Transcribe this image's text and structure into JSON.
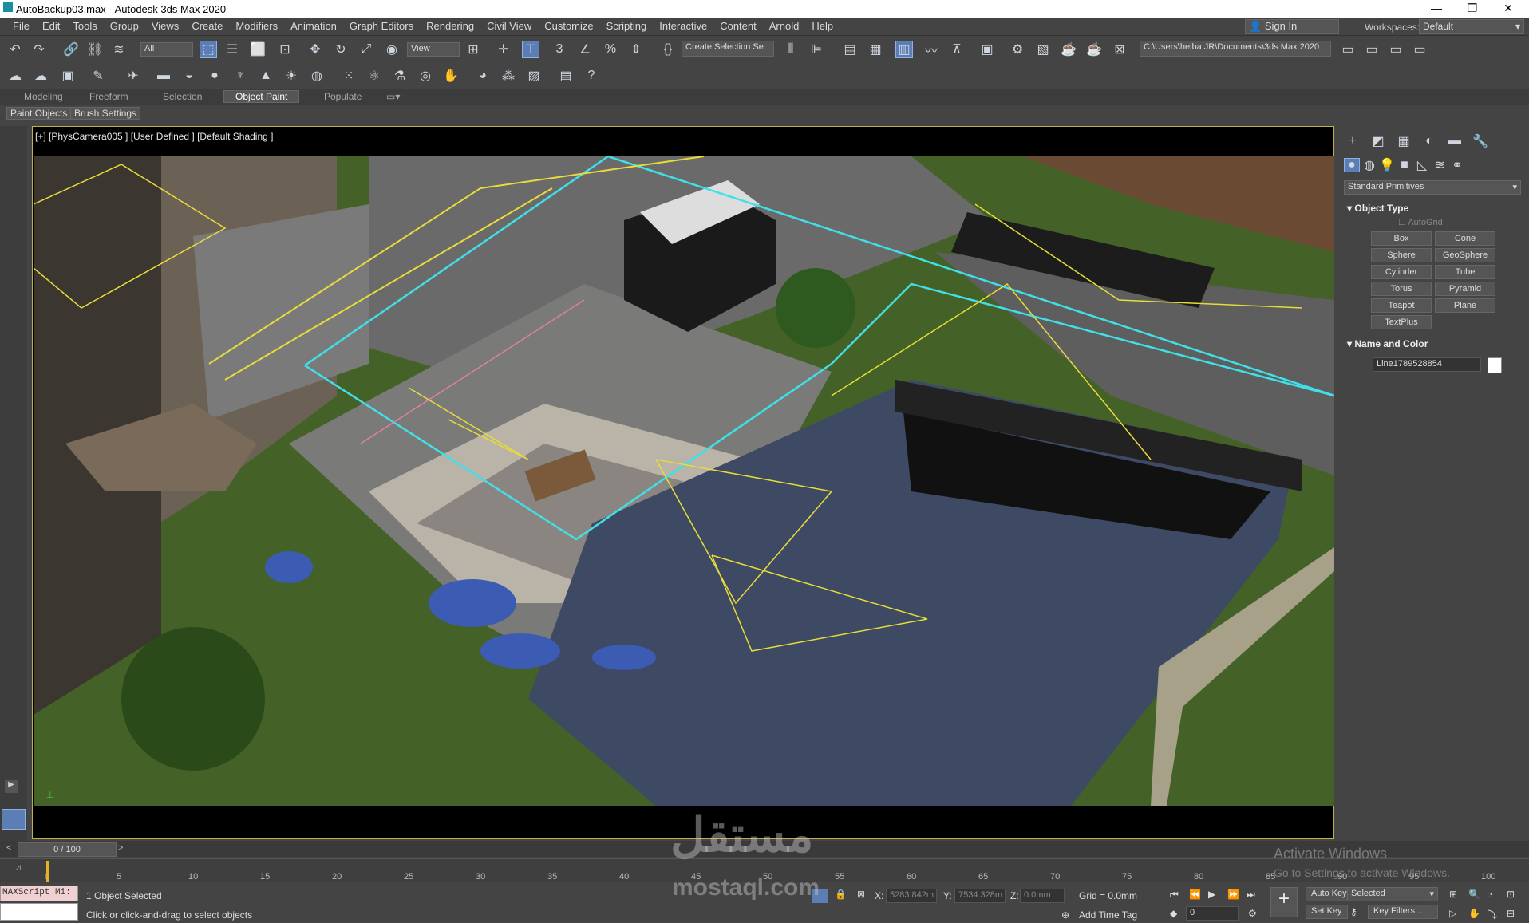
{
  "window": {
    "title": "AutoBackup03.max - Autodesk 3ds Max 2020",
    "minimize": "—",
    "maximize": "❐",
    "close": "✕"
  },
  "menu": {
    "items": [
      "File",
      "Edit",
      "Tools",
      "Group",
      "Views",
      "Create",
      "Modifiers",
      "Animation",
      "Graph Editors",
      "Rendering",
      "Civil View",
      "Customize",
      "Scripting",
      "Interactive",
      "Content",
      "Arnold",
      "Help"
    ],
    "sign_in": "Sign In",
    "workspaces_label": "Workspaces:",
    "workspaces_value": "Default"
  },
  "toolbar": {
    "filter": "All",
    "ref_coord": "View",
    "selection_set": "Create Selection Se",
    "project_path": "C:\\Users\\heiba JR\\Documents\\3ds Max 2020"
  },
  "ribbon": {
    "tabs": [
      "Modeling",
      "Freeform",
      "Selection",
      "Object Paint",
      "Populate"
    ],
    "active_tab": "Object Paint",
    "sub_buttons": [
      "Paint Objects",
      "Brush Settings"
    ]
  },
  "viewport": {
    "label": "[+] [PhysCamera005 ] [User Defined ] [Default Shading ]"
  },
  "command_panel": {
    "category": "Standard Primitives",
    "object_type_title": "Object Type",
    "autogrid": "AutoGrid",
    "buttons": [
      "Box",
      "Cone",
      "Sphere",
      "GeoSphere",
      "Cylinder",
      "Tube",
      "Torus",
      "Pyramid",
      "Teapot",
      "Plane",
      "TextPlus"
    ],
    "name_color_title": "Name and Color",
    "object_name": "Line1789528854",
    "object_color": "#ffffff"
  },
  "timeline": {
    "frame_display": "0 / 100",
    "ticks": [
      "0",
      "5",
      "10",
      "15",
      "20",
      "25",
      "30",
      "35",
      "40",
      "45",
      "50",
      "55",
      "60",
      "65",
      "70",
      "75",
      "80",
      "85",
      "90",
      "95",
      "100"
    ]
  },
  "status": {
    "maxscript": "MAXScript Mi:",
    "selected_count": "1 Object Selected",
    "prompt": "Click or click-and-drag to select objects",
    "x_label": "X:",
    "x_value": "5283.842m",
    "y_label": "Y:",
    "y_value": "7534.328m",
    "z_label": "Z:",
    "z_value": "0.0mm",
    "grid": "Grid = 0.0mm",
    "add_time_tag": "Add Time Tag",
    "auto_key": "Auto Key",
    "set_key": "Set Key",
    "key_mode": "Selected",
    "key_filters": "Key Filters...",
    "current_frame": "0"
  },
  "overlay": {
    "activate_title": "Activate Windows",
    "activate_sub": "Go to Settings to activate Windows.",
    "watermark_ar": "مستقل",
    "watermark_en": "mostaql.com"
  }
}
